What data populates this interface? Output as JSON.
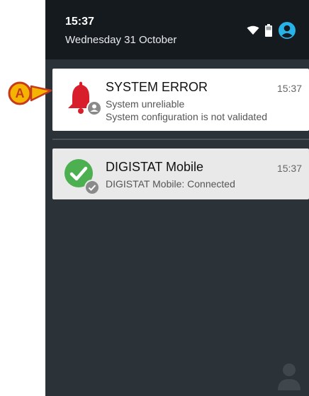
{
  "status_bar": {
    "time": "15:37",
    "date": "Wednesday 31 October",
    "icons": [
      "wifi-icon",
      "battery-icon",
      "account-icon"
    ]
  },
  "notifications": [
    {
      "icon": "bell-icon",
      "badge_icon": "user-badge-icon",
      "title": "SYSTEM ERROR",
      "time": "15:37",
      "lines": [
        "System unreliable",
        "System configuration is not validated"
      ],
      "accent": "#d81e2b"
    },
    {
      "icon": "check-circle-icon",
      "badge_icon": "check-badge-icon",
      "title": "DIGISTAT Mobile",
      "time": "15:37",
      "lines": [
        "DIGISTAT Mobile: Connected"
      ],
      "accent": "#4caf50"
    }
  ],
  "annotation": {
    "label": "A",
    "color": "#f5b400"
  },
  "colors": {
    "shade_background": "#2b3238",
    "status_bar": "#151a1f",
    "account_icon": "#27b3e8"
  }
}
